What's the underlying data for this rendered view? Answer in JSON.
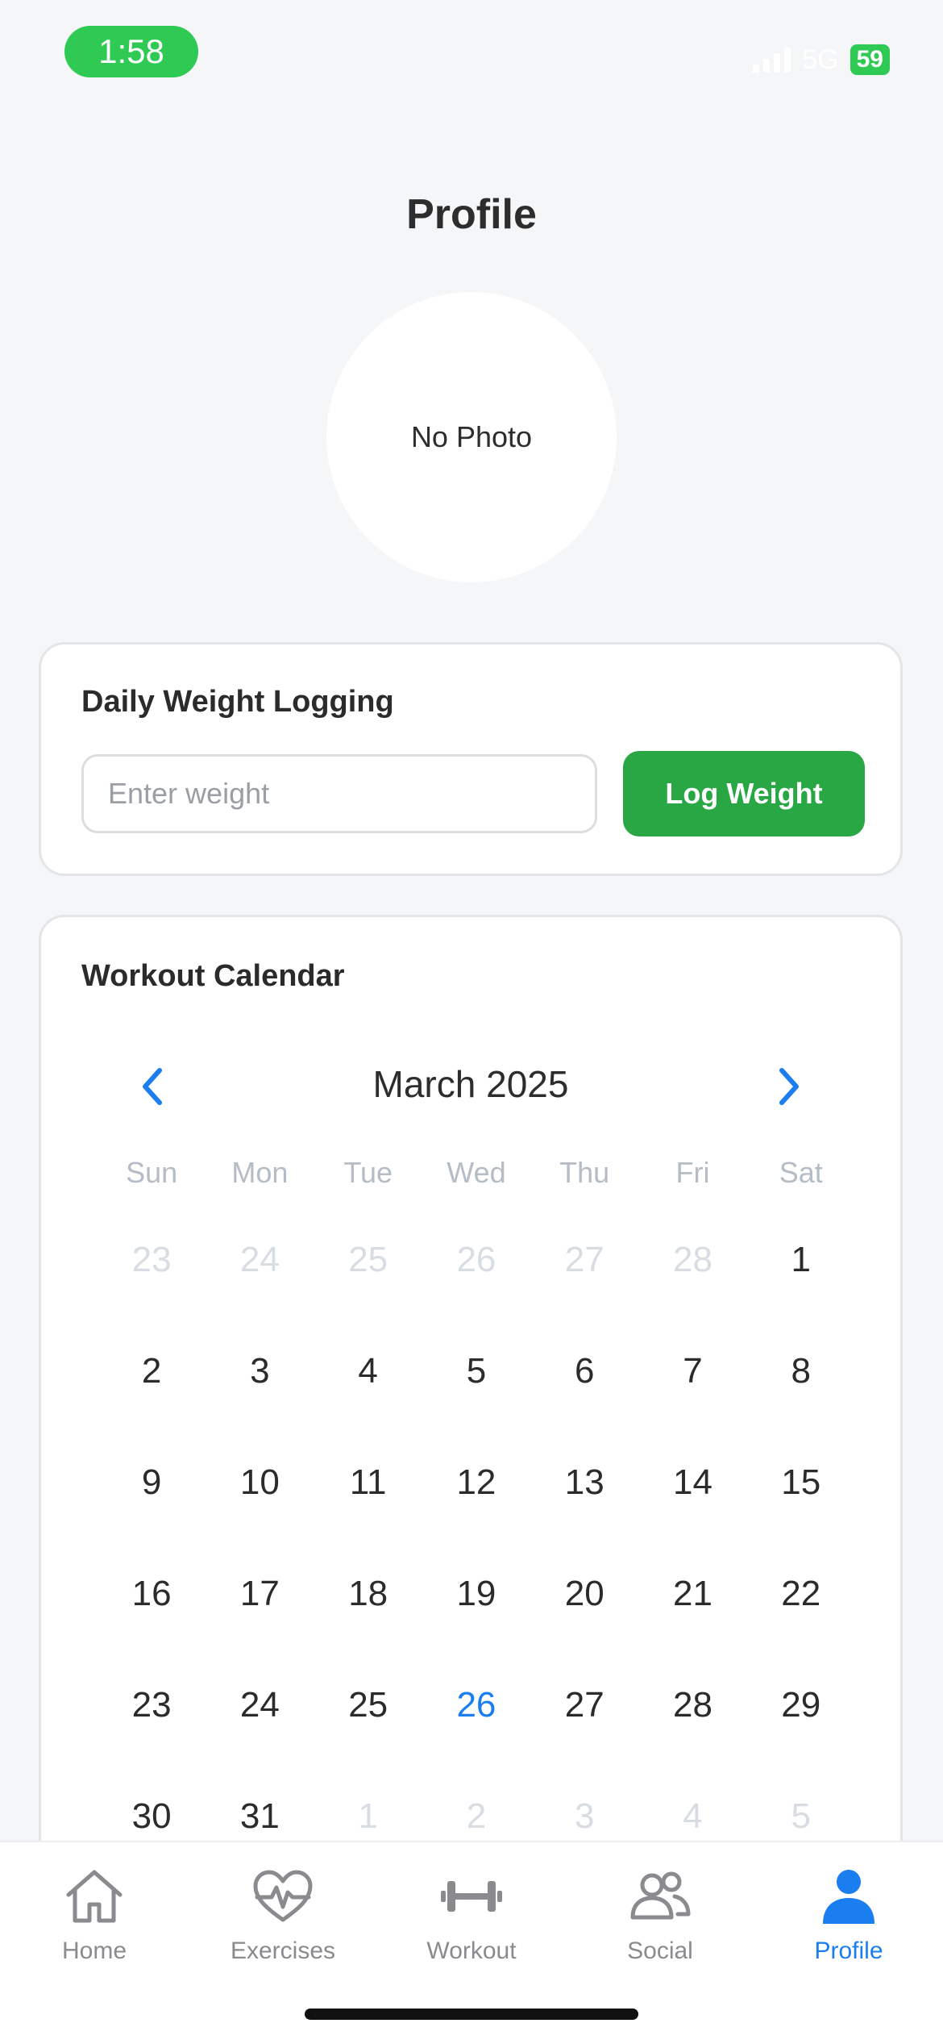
{
  "status_bar": {
    "time": "1:58",
    "network": "5G",
    "battery": "59"
  },
  "page": {
    "title": "Profile"
  },
  "avatar": {
    "placeholder_text": "No Photo"
  },
  "weight_logging": {
    "title": "Daily Weight Logging",
    "input_value": "",
    "input_placeholder": "Enter weight",
    "button_label": "Log Weight"
  },
  "calendar": {
    "title": "Workout Calendar",
    "month_label": "March 2025",
    "weekdays": [
      "Sun",
      "Mon",
      "Tue",
      "Wed",
      "Thu",
      "Fri",
      "Sat"
    ],
    "weeks": [
      [
        {
          "d": "23",
          "muted": true
        },
        {
          "d": "24",
          "muted": true
        },
        {
          "d": "25",
          "muted": true
        },
        {
          "d": "26",
          "muted": true
        },
        {
          "d": "27",
          "muted": true
        },
        {
          "d": "28",
          "muted": true
        },
        {
          "d": "1"
        }
      ],
      [
        {
          "d": "2"
        },
        {
          "d": "3"
        },
        {
          "d": "4"
        },
        {
          "d": "5"
        },
        {
          "d": "6"
        },
        {
          "d": "7"
        },
        {
          "d": "8"
        }
      ],
      [
        {
          "d": "9"
        },
        {
          "d": "10"
        },
        {
          "d": "11"
        },
        {
          "d": "12"
        },
        {
          "d": "13"
        },
        {
          "d": "14"
        },
        {
          "d": "15"
        }
      ],
      [
        {
          "d": "16"
        },
        {
          "d": "17"
        },
        {
          "d": "18"
        },
        {
          "d": "19"
        },
        {
          "d": "20"
        },
        {
          "d": "21"
        },
        {
          "d": "22"
        }
      ],
      [
        {
          "d": "23"
        },
        {
          "d": "24"
        },
        {
          "d": "25"
        },
        {
          "d": "26",
          "today": true
        },
        {
          "d": "27"
        },
        {
          "d": "28"
        },
        {
          "d": "29"
        }
      ],
      [
        {
          "d": "30"
        },
        {
          "d": "31"
        },
        {
          "d": "1",
          "muted": true
        },
        {
          "d": "2",
          "muted": true
        },
        {
          "d": "3",
          "muted": true
        },
        {
          "d": "4",
          "muted": true
        },
        {
          "d": "5",
          "muted": true
        }
      ]
    ]
  },
  "tabs": [
    {
      "label": "Home",
      "icon": "home-icon"
    },
    {
      "label": "Exercises",
      "icon": "heart-pulse-icon"
    },
    {
      "label": "Workout",
      "icon": "dumbbell-icon"
    },
    {
      "label": "Social",
      "icon": "people-icon"
    },
    {
      "label": "Profile",
      "icon": "person-icon",
      "active": true
    }
  ],
  "colors": {
    "accent": "#1a7ef1",
    "log_button": "#29a745",
    "status_green": "#2fca54",
    "background": "#f5f6f8"
  }
}
